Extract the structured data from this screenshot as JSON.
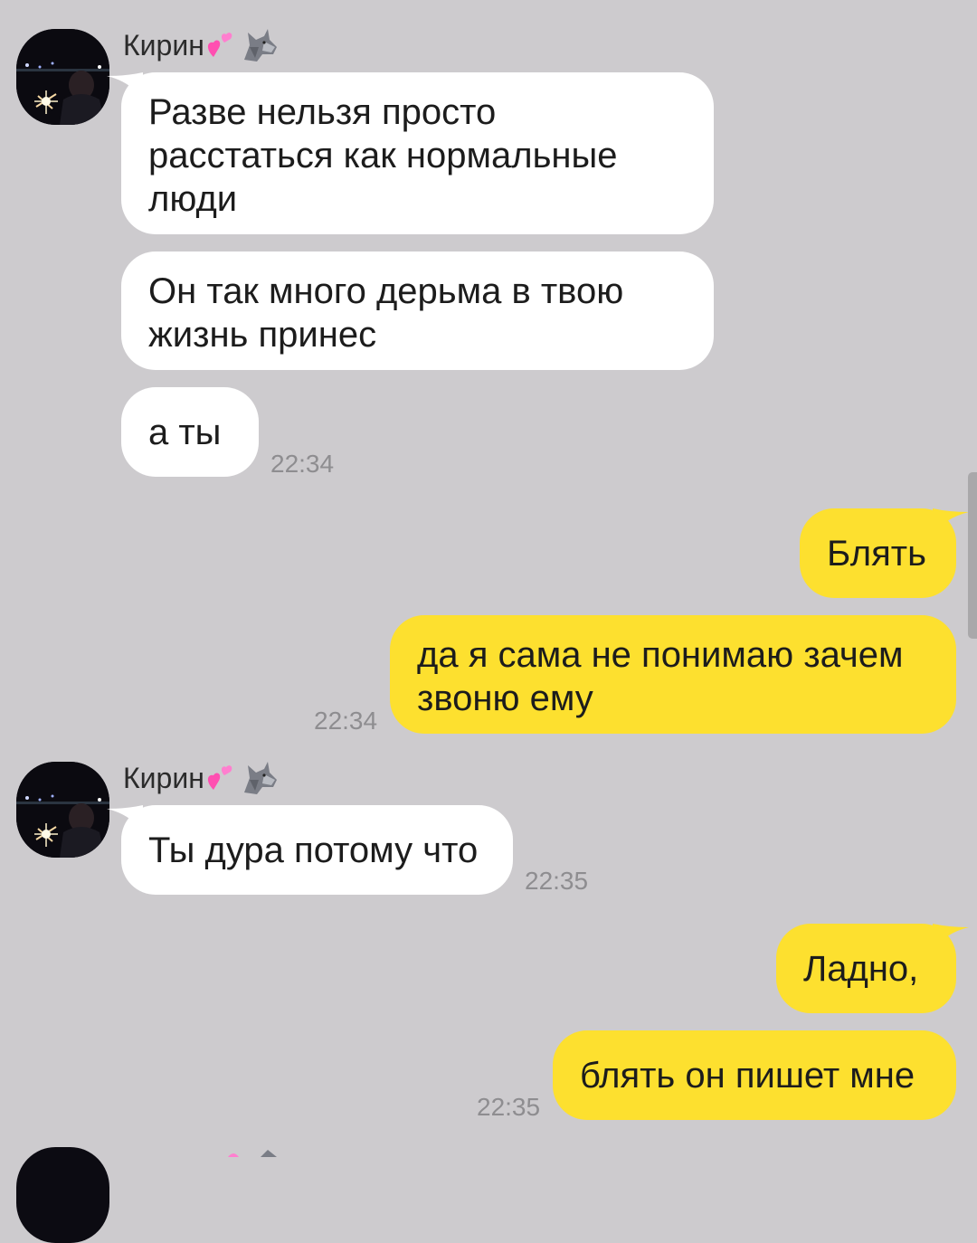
{
  "chat": {
    "messages": [
      {
        "sender": "Кирин",
        "text": "Разве нельзя просто расстаться как нормальные люди"
      },
      {
        "sender": "Кирин",
        "text": "Он так много дерьма в твою жизнь принес"
      },
      {
        "sender": "Кирин",
        "text": "а ты",
        "time": "22:34"
      },
      {
        "sender": "me",
        "text": "Блять"
      },
      {
        "sender": "me",
        "text": "да я сама не понимаю зачем звоню ему",
        "time": "22:34"
      },
      {
        "sender": "Кирин",
        "text": "Ты дура потому что",
        "time": "22:35"
      },
      {
        "sender": "me",
        "text": "Ладно,"
      },
      {
        "sender": "me",
        "text": "блять он пишет мне",
        "time": "22:35"
      }
    ]
  },
  "contact": {
    "name": "Кирин",
    "emoji_icons": [
      "hearts-icon",
      "wolf-icon"
    ]
  },
  "colors": {
    "background": "#cdcbce",
    "incoming_bubble": "#ffffff",
    "outgoing_bubble": "#fde02f",
    "timestamp": "#8e8d90"
  }
}
